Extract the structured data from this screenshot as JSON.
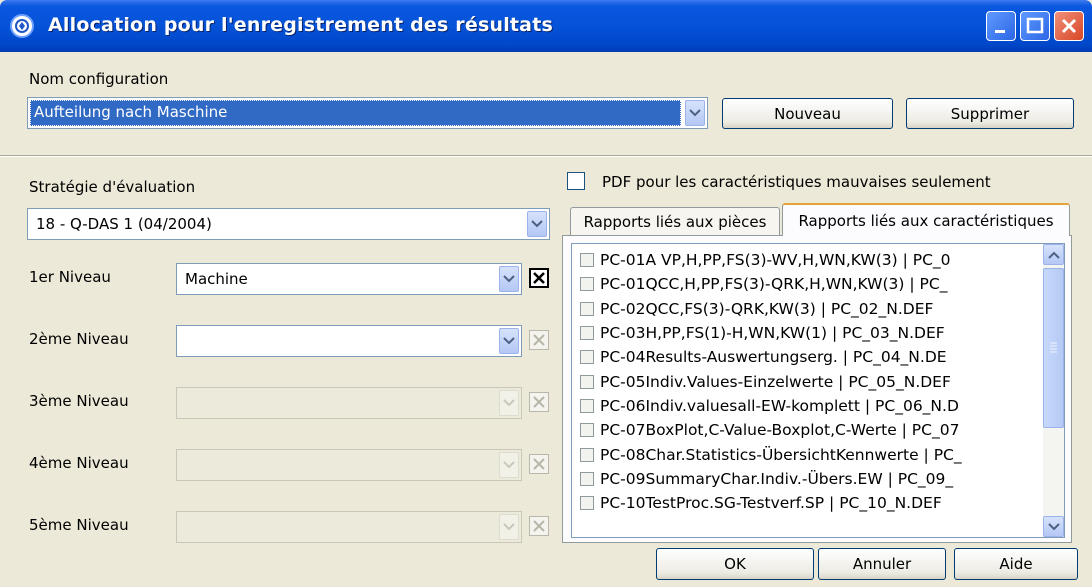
{
  "window": {
    "title": "Allocation pour l'enregistrement des résultats"
  },
  "config": {
    "label": "Nom configuration",
    "value": "Aufteilung nach Maschine",
    "new_button": "Nouveau",
    "delete_button": "Supprimer"
  },
  "strategy": {
    "label": "Stratégie d'évaluation",
    "value": "18 - Q-DAS 1 (04/2004)"
  },
  "levels": [
    {
      "label": "1er Niveau",
      "value": "Machine"
    },
    {
      "label": "2ème Niveau",
      "value": ""
    },
    {
      "label": "3ème Niveau",
      "value": ""
    },
    {
      "label": "4ème Niveau",
      "value": ""
    },
    {
      "label": "5ème Niveau",
      "value": ""
    }
  ],
  "pdf_option": {
    "label": "PDF pour les caractéristiques mauvaises seulement",
    "checked": false
  },
  "tabs": [
    {
      "label": "Rapports liés aux pièces",
      "active": false
    },
    {
      "label": "Rapports liés aux caractéristiques",
      "active": true
    }
  ],
  "reports": [
    "PC-01A VP,H,PP,FS(3)-WV,H,WN,KW(3) | PC_0",
    "PC-01QCC,H,PP,FS(3)-QRK,H,WN,KW(3) | PC_",
    "PC-02QCC,FS(3)-QRK,KW(3) | PC_02_N.DEF",
    "PC-03H,PP,FS(1)-H,WN,KW(1) | PC_03_N.DEF",
    "PC-04Results-Auswertungserg. | PC_04_N.DE",
    "PC-05Indiv.Values-Einzelwerte | PC_05_N.DEF",
    "PC-06Indiv.valuesall-EW-komplett | PC_06_N.D",
    "PC-07BoxPlot,C-Value-Boxplot,C-Werte | PC_07",
    "PC-08Char.Statistics-ÜbersichtKennwerte | PC_",
    "PC-09SummaryChar.Indiv.-Übers.EW | PC_09_",
    "PC-10TestProc.SG-Testverf.SP | PC_10_N.DEF"
  ],
  "footer": {
    "ok": "OK",
    "cancel": "Annuler",
    "help": "Aide"
  },
  "colors": {
    "titlebar": "#0553d8",
    "dialog_bg": "#ece9d8",
    "selection": "#316ac5",
    "tab_highlight": "#e6a33a"
  }
}
